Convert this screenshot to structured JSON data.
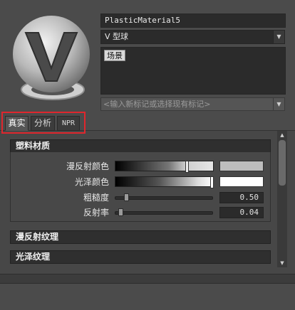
{
  "material": {
    "name": "PlasticMaterial5",
    "view_mode": "V 型球",
    "tags": [
      "场景"
    ],
    "tag_placeholder": "<输入新标记或选择现有标记>"
  },
  "tabs": [
    {
      "label": "真实",
      "active": true
    },
    {
      "label": "分析",
      "active": false
    },
    {
      "label": "NPR",
      "active": false
    }
  ],
  "sections": {
    "plastic": {
      "title": "塑料材质",
      "diffuse_color_label": "漫反射颜色",
      "gloss_color_label": "光泽颜色",
      "roughness_label": "粗糙度",
      "roughness_value": "0.50",
      "reflectivity_label": "反射率",
      "reflectivity_value": "0.04",
      "diffuse_swatch_color": "#bdbdbd",
      "gloss_swatch_color": "#ffffff"
    },
    "diffuse_texture": {
      "title": "漫反射纹理"
    },
    "gloss_texture": {
      "title": "光泽纹理"
    }
  },
  "icons": {
    "dropdown": "▼",
    "scroll_up": "▲",
    "scroll_down": "▼"
  },
  "colors": {
    "highlight": "#e0262d"
  }
}
